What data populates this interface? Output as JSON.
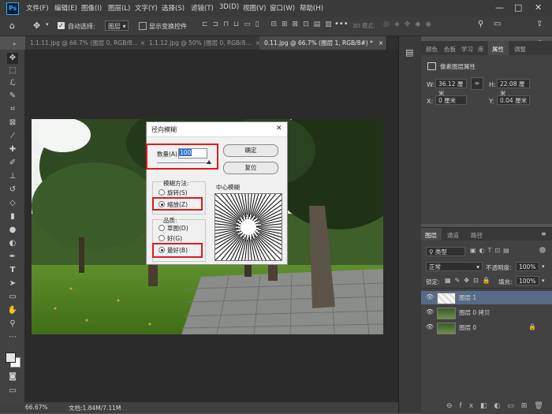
{
  "app": {
    "logo": "Ps"
  },
  "menu": [
    "文件(F)",
    "编辑(E)",
    "图像(I)",
    "图层(L)",
    "文字(Y)",
    "选择(S)",
    "滤镜(T)",
    "3D(D)",
    "视图(V)",
    "窗口(W)",
    "帮助(H)"
  ],
  "window_controls": [
    "—",
    "□",
    "✕"
  ],
  "options": {
    "auto_select_label": "自动选择:",
    "auto_select_value": "图层",
    "transform_label": "显示变换控件",
    "mode3d_label": "3D 模式:"
  },
  "tabs": [
    {
      "label": "1.1.11.jpg @ 66.7% (图层 0, RGB/8...",
      "close": "×"
    },
    {
      "label": "1.1.12.jpg @ 50% (图层 0, RGB/8...",
      "close": "×"
    },
    {
      "label": "0.11.jpg @ 66.7% (图层 1, RGB/8#) *",
      "close": "×"
    }
  ],
  "status": {
    "zoom": "66.67%",
    "doc": "文档:1.84M/7.11M",
    "arrow": "›"
  },
  "properties": {
    "tabs": [
      "颜色",
      "色板",
      "学习",
      "库",
      "属性",
      "调整"
    ],
    "header": "像素图层属性",
    "w_label": "W:",
    "w_value": "36.12 厘米",
    "h_label": "H:",
    "h_value": "22.08 厘米",
    "x_label": "X:",
    "x_value": "0 厘米",
    "y_label": "Y:",
    "y_value": "0.04 厘米"
  },
  "layers_panel": {
    "tabs": [
      "图层",
      "通道",
      "路径"
    ],
    "filter_label": "类型",
    "blend_mode": "正常",
    "opacity_label": "不透明度:",
    "opacity_value": "100%",
    "lock_label": "锁定:",
    "fill_label": "填充:",
    "fill_value": "100%",
    "layers": [
      {
        "name": "图层 1",
        "selected": true
      },
      {
        "name": "图层 0 拷贝",
        "selected": false
      },
      {
        "name": "图层 0",
        "selected": false,
        "locked": true
      }
    ]
  },
  "dialog": {
    "title": "径向模糊",
    "close": "✕",
    "amount_label": "数量(A)",
    "amount_value": "100",
    "ok_label": "确定",
    "reset_label": "复位",
    "method_label": "模糊方法:",
    "method_spin": "旋转(S)",
    "method_zoom": "缩放(Z)",
    "quality_label": "品质:",
    "quality_draft": "草图(D)",
    "quality_good": "好(G)",
    "quality_best": "最好(B)",
    "center_label": "中心模糊"
  },
  "colors": {
    "highlight": "#d81e1e",
    "accent": "#2d6fd6"
  }
}
